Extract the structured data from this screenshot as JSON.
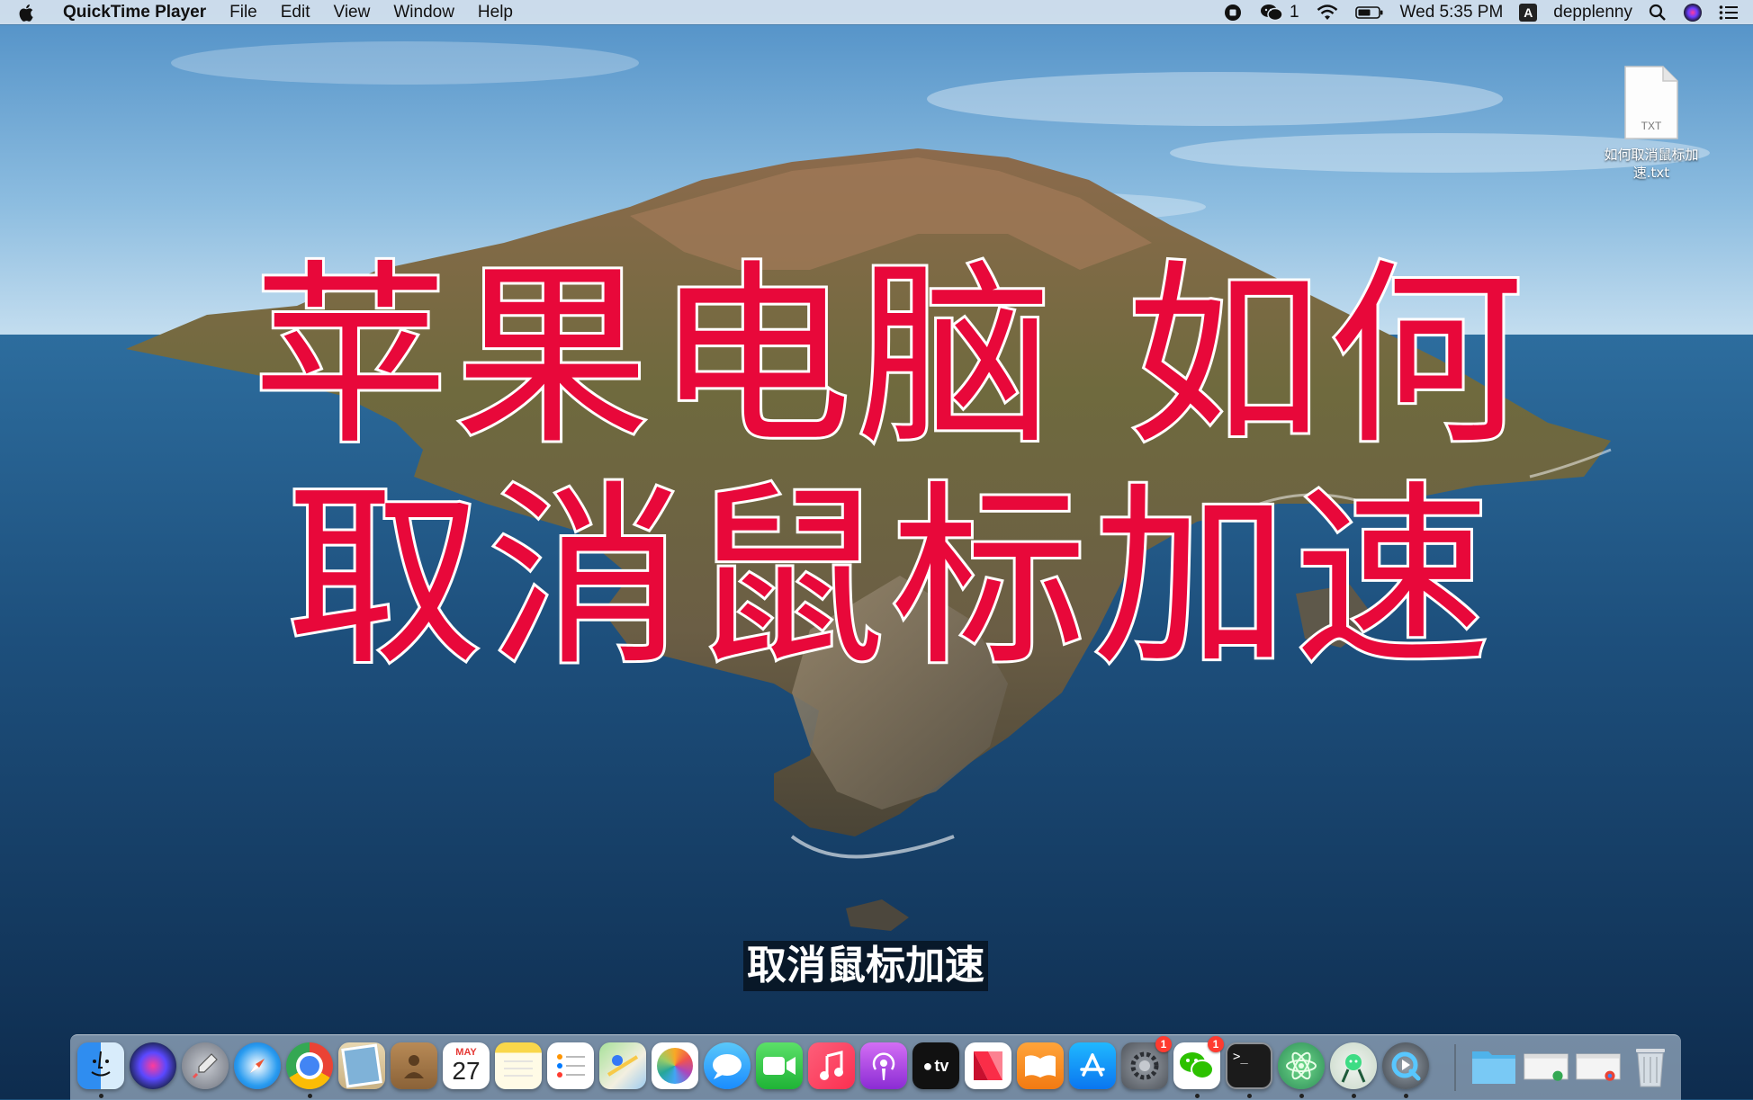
{
  "menubar": {
    "apple_icon": "apple-logo-icon",
    "app_name": "QuickTime Player",
    "menus": [
      "File",
      "Edit",
      "View",
      "Window",
      "Help"
    ],
    "status": {
      "wechat_count": "1",
      "datetime": "Wed 5:35 PM",
      "input_source": "A",
      "username": "depplenny"
    }
  },
  "desktop": {
    "file": {
      "type_label": "TXT",
      "name_line1": "如何取消鼠标加",
      "name_line2": "速.txt"
    }
  },
  "overlay": {
    "line1": "苹果电脑 如何",
    "line2": "取消鼠标加速",
    "color": "#e8083a"
  },
  "subtitle": "取消鼠标加速",
  "dock": {
    "calendar_month": "MAY",
    "calendar_day": "27",
    "tv_label": "tv",
    "system_prefs_badge": "1",
    "wechat_badge": "1",
    "terminal_prompt": ">_",
    "items": [
      "finder-icon",
      "siri-icon",
      "launchpad-icon",
      "safari-icon",
      "chrome-icon",
      "preview-icon",
      "contacts-icon",
      "calendar-icon",
      "notes-icon",
      "reminders-icon",
      "maps-icon",
      "photos-icon",
      "messages-icon",
      "facetime-icon",
      "music-icon",
      "podcasts-icon",
      "apple-tv-icon",
      "news-icon",
      "books-icon",
      "app-store-icon",
      "system-preferences-icon",
      "wechat-icon",
      "terminal-icon",
      "atom-icon",
      "android-studio-icon",
      "quicktime-icon",
      "downloads-folder-icon",
      "recent-document-icon",
      "chrome-window-icon",
      "trash-icon"
    ]
  }
}
